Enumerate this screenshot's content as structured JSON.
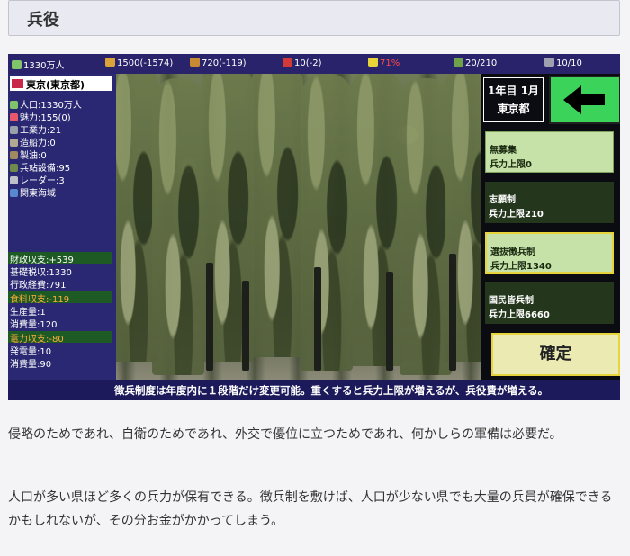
{
  "heading": "兵役",
  "topbar": {
    "population": "1330万人",
    "money": "1500(-1574)",
    "food": "720(-119)",
    "power": "10(-2)",
    "approval": "71%",
    "count_a": "20/210",
    "count_b": "10/10"
  },
  "prefecture": {
    "name": "東京(東京都)",
    "stats": [
      "人口:1330万人",
      "魅力:155(0)",
      "工業力:21",
      "造船力:0",
      "製油:0",
      "兵站設備:95",
      "レーダー:3",
      "関東海域"
    ],
    "finance": [
      "財政収支:+539",
      "基礎税収:1330",
      "行政経費:791"
    ],
    "food": [
      "食料収支:-119",
      "生産量:1",
      "消費量:120"
    ],
    "power": [
      "電力収支:-80",
      "発電量:10",
      "消費量:90"
    ]
  },
  "date": {
    "year_month": "1年目 1月",
    "capital": "東京都"
  },
  "options": [
    {
      "name": "無募集",
      "cap": "兵力上限0",
      "style": "light"
    },
    {
      "name": "志願制",
      "cap": "兵力上限210",
      "style": "dark"
    },
    {
      "name": "選抜徴兵制",
      "cap": "兵力上限1340",
      "style": "sel"
    },
    {
      "name": "国民皆兵制",
      "cap": "兵力上限6660",
      "style": "dark"
    }
  ],
  "confirm_label": "確定",
  "caption": "徴兵制度は年度内に１段階だけ変更可能。重くすると兵力上限が増えるが、兵役費が増える。",
  "paragraphs": [
    "侵略のためであれ、自衛のためであれ、外交で優位に立つためであれ、何かしらの軍備は必要だ。",
    "人口が多い県ほど多くの兵力が保有できる。徴兵制を敷けば、人口が少ない県でも大量の兵員が確保できるかもしれないが、その分お金がかかってしまう。"
  ],
  "colors": {
    "topbar": "#28236a",
    "panel": "#2a2872",
    "accent_green": "#3bd35a",
    "confirm": "#eaeab2"
  }
}
